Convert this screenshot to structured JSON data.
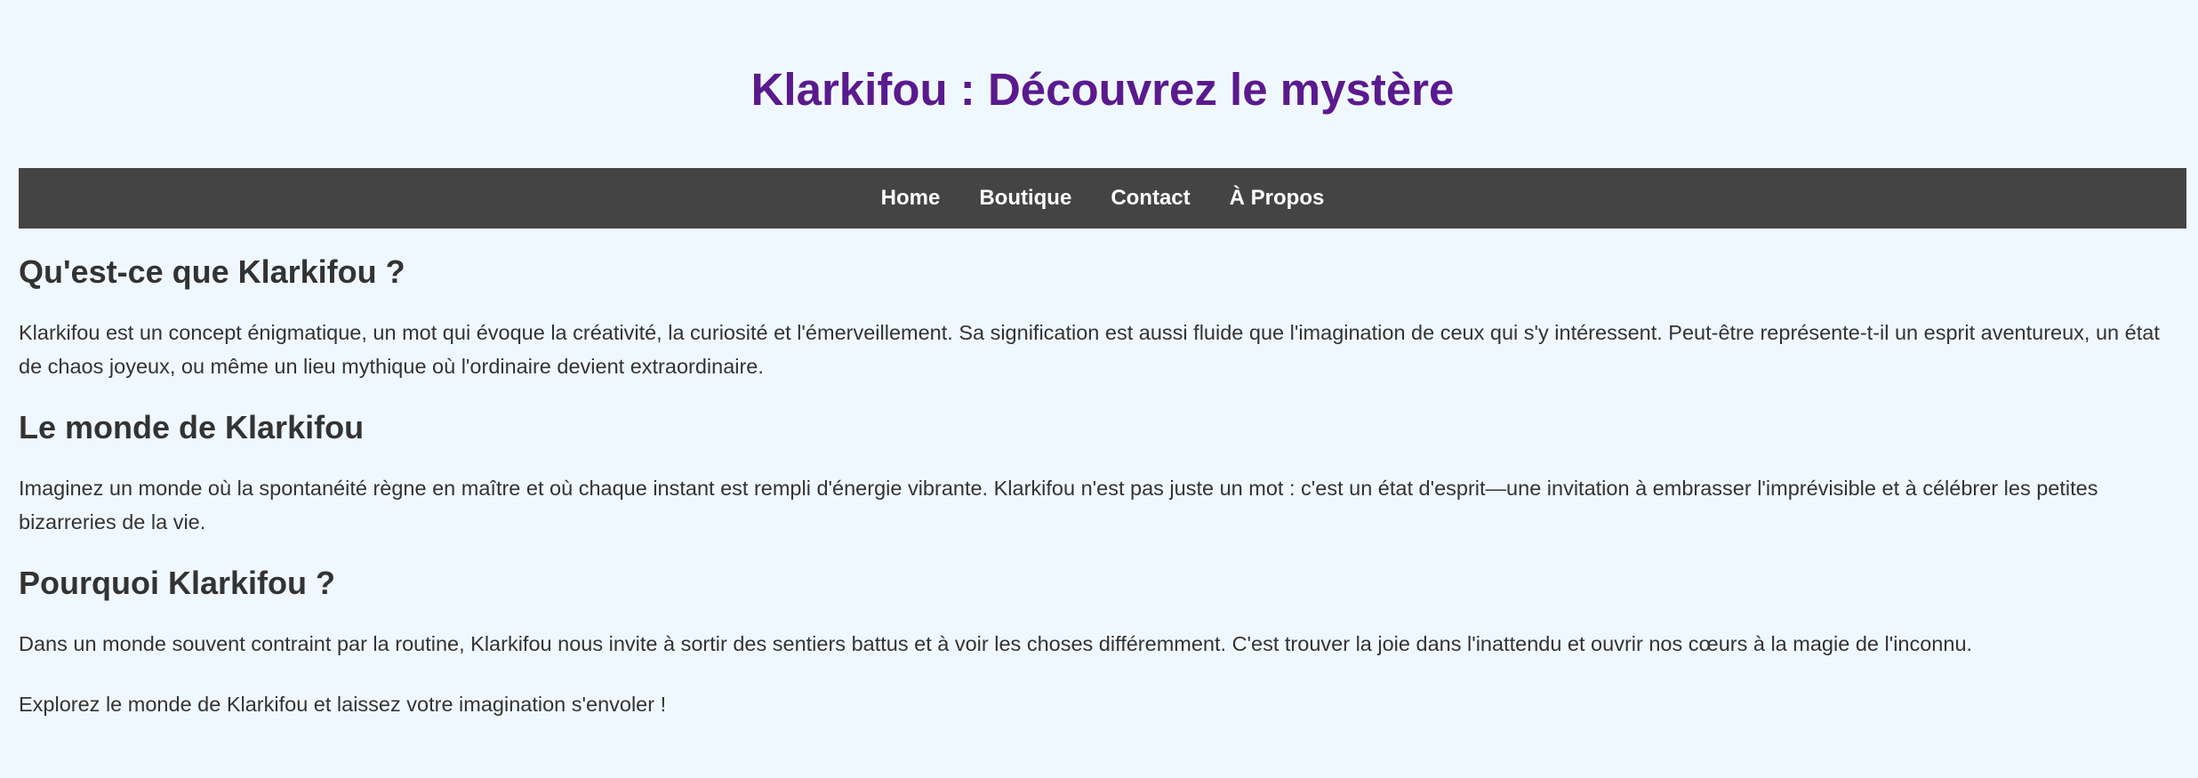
{
  "header": {
    "title": "Klarkifou : Découvrez le mystère"
  },
  "nav": {
    "items": [
      {
        "label": "Home"
      },
      {
        "label": "Boutique"
      },
      {
        "label": "Contact"
      },
      {
        "label": "À Propos"
      }
    ]
  },
  "sections": [
    {
      "heading": "Qu'est-ce que Klarkifou ?",
      "text": "Klarkifou est un concept énigmatique, un mot qui évoque la créativité, la curiosité et l'émerveillement. Sa signification est aussi fluide que l'imagination de ceux qui s'y intéressent. Peut-être représente-t-il un esprit aventureux, un état de chaos joyeux, ou même un lieu mythique où l'ordinaire devient extraordinaire."
    },
    {
      "heading": "Le monde de Klarkifou",
      "text": "Imaginez un monde où la spontanéité règne en maître et où chaque instant est rempli d'énergie vibrante. Klarkifou n'est pas juste un mot : c'est un état d'esprit—une invitation à embrasser l'imprévisible et à célébrer les petites bizarreries de la vie."
    },
    {
      "heading": "Pourquoi Klarkifou ?",
      "text": "Dans un monde souvent contraint par la routine, Klarkifou nous invite à sortir des sentiers battus et à voir les choses différemment. C'est trouver la joie dans l'inattendu et ouvrir nos cœurs à la magie de l'inconnu."
    }
  ],
  "closing": "Explorez le monde de Klarkifou et laissez votre imagination s'envoler !",
  "colors": {
    "background": "#f0f8ff",
    "title": "#5a1a8e",
    "nav_background": "#444444",
    "nav_text": "#ffffff",
    "body_text": "#333333"
  }
}
